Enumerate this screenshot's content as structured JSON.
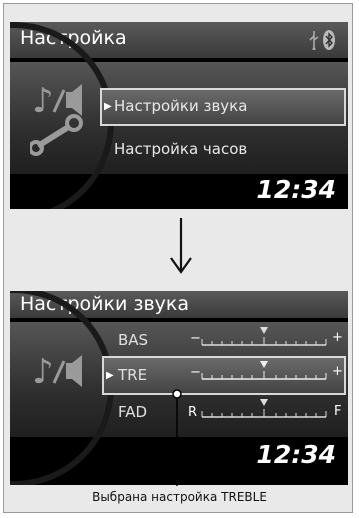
{
  "screen1": {
    "title": "Настройка",
    "usb_icon": "usb-icon",
    "bluetooth_icon": "bluetooth-icon",
    "menu_items": [
      {
        "label": "Настройки звука",
        "selected": true
      },
      {
        "label": "Настройка часов",
        "selected": false
      }
    ],
    "clock": "12:34"
  },
  "screen2": {
    "title": "Настройки звука",
    "rows": [
      {
        "label": "BAS",
        "left": "−",
        "right": "+",
        "selected": false
      },
      {
        "label": "TRE",
        "left": "−",
        "right": "+",
        "selected": true
      },
      {
        "label": "FAD",
        "left": "R",
        "right": "F",
        "selected": false
      }
    ],
    "clock": "12:34"
  },
  "caption": "Выбрана настройка TREBLE",
  "colors": {
    "screen_bg": "#000000",
    "highlight_border": "#d8d8d8"
  }
}
